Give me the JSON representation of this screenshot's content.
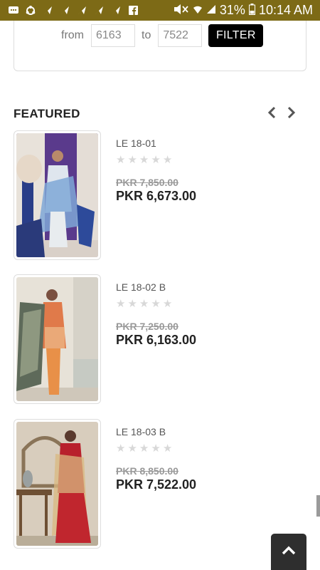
{
  "status_bar": {
    "battery": "31%",
    "time": "10:14 AM",
    "bg_color": "#7d6a16"
  },
  "price_filter": {
    "from_label": "from",
    "from_value": "6163",
    "to_label": "to",
    "to_value": "7522",
    "button_label": "FILTER"
  },
  "featured": {
    "title": "FEATURED",
    "products": [
      {
        "name": "LE 18-01",
        "rating": 0,
        "old_price": "PKR 7,850.00",
        "new_price": "PKR 6,673.00"
      },
      {
        "name": "LE 18-02 B",
        "rating": 0,
        "old_price": "PKR 7,250.00",
        "new_price": "PKR 6,163.00"
      },
      {
        "name": "LE 18-03 B",
        "rating": 0,
        "old_price": "PKR 8,850.00",
        "new_price": "PKR 7,522.00"
      }
    ]
  }
}
